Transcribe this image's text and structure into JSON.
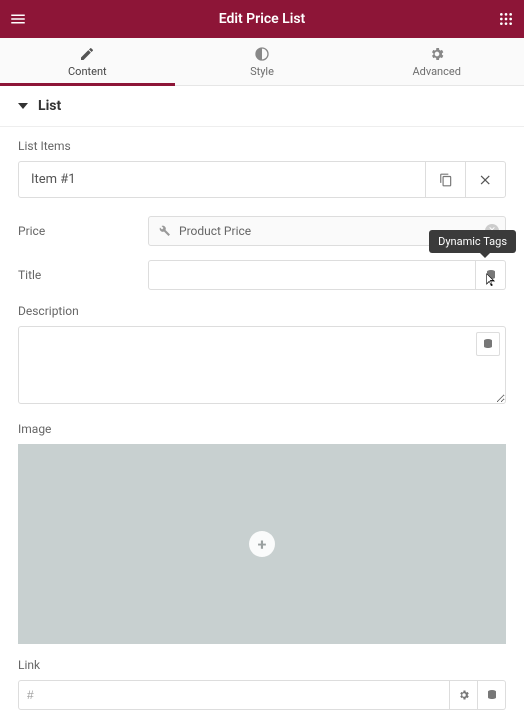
{
  "header": {
    "title": "Edit Price List"
  },
  "tabs": {
    "content": "Content",
    "style": "Style",
    "advanced": "Advanced",
    "active": "content"
  },
  "section": {
    "title": "List"
  },
  "list": {
    "items_label": "List Items",
    "item1": {
      "title": "Item #1"
    }
  },
  "fields": {
    "price": {
      "label": "Price",
      "chip_text": "Product Price"
    },
    "title": {
      "label": "Title",
      "value": "",
      "tooltip": "Dynamic Tags"
    },
    "description": {
      "label": "Description",
      "value": ""
    },
    "image": {
      "label": "Image"
    },
    "link": {
      "label": "Link",
      "value": "#"
    }
  },
  "icons": {
    "menu": "menu-icon",
    "apps": "apps-icon",
    "pencil": "pencil-icon",
    "contrast": "contrast-icon",
    "gear": "gear-icon",
    "copy": "copy-icon",
    "close": "close-icon",
    "wrench": "wrench-icon",
    "database": "database-icon",
    "plus": "plus-icon"
  }
}
